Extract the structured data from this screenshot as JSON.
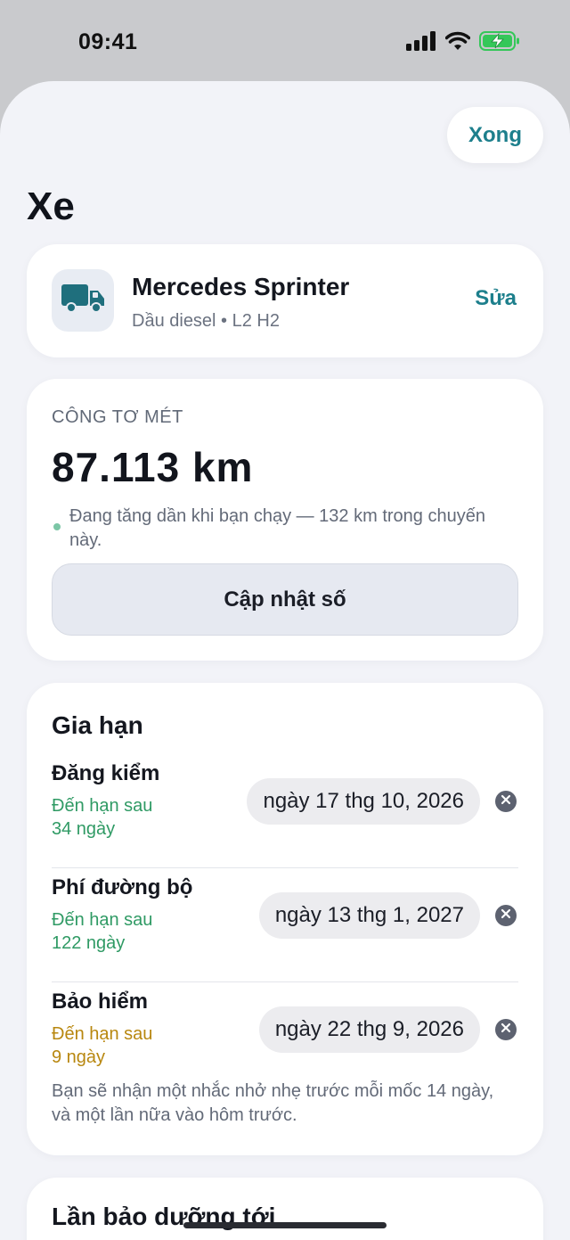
{
  "status_bar": {
    "time": "09:41"
  },
  "header": {
    "done_label": "Xong",
    "title": "Xe"
  },
  "vehicle": {
    "name": "Mercedes Sprinter",
    "details": "Dầu diesel • L2 H2",
    "edit_label": "Sửa",
    "icon": "truck-icon"
  },
  "odometer": {
    "label": "CÔNG TƠ MÉT",
    "value": "87.113 km",
    "note": "Đang tăng dần khi bạn chạy — 132 km trong chuyến này.",
    "update_label": "Cập nhật số"
  },
  "renewals": {
    "title": "Gia hạn",
    "items": [
      {
        "name": "Đăng kiểm",
        "due_prefix": "Đến hạn sau",
        "due_days": "34 ngày",
        "date": "ngày 17 thg 10, 2026",
        "status": "ok"
      },
      {
        "name": "Phí đường bộ",
        "due_prefix": "Đến hạn sau",
        "due_days": "122 ngày",
        "date": "ngày 13 thg 1, 2027",
        "status": "ok"
      },
      {
        "name": "Bảo hiểm",
        "due_prefix": "Đến hạn sau",
        "due_days": "9 ngày",
        "date": "ngày 22 thg 9, 2026",
        "status": "soon"
      }
    ],
    "footnote": "Bạn sẽ nhận một nhắc nhở nhẹ trước mỗi mốc 14 ngày, và một lần nữa vào hôm trước."
  },
  "next_service": {
    "title": "Lần bảo dưỡng tới"
  },
  "colors": {
    "accent": "#1d7f8c",
    "status_ok": "#2f9a64",
    "status_soon": "#b8870f",
    "battery": "#34c759"
  }
}
